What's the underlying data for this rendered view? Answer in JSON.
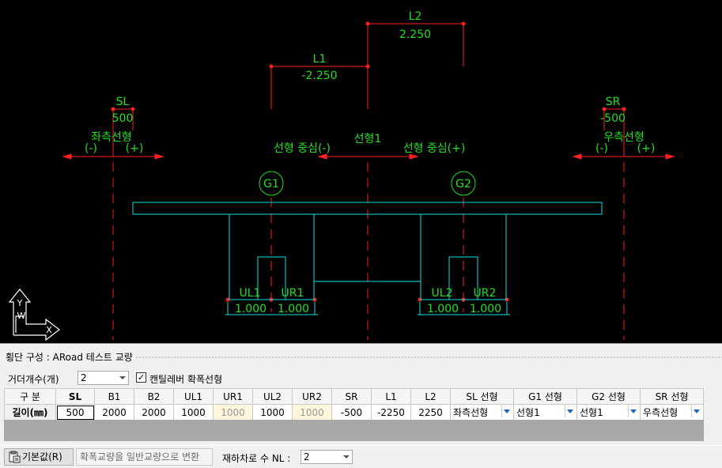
{
  "drawing": {
    "L2_label": "L2",
    "L2_value": "2.250",
    "L1_label": "L1",
    "L1_value": "-2.250",
    "SL_label": "SL",
    "SL_value": "500",
    "SR_label": "SR",
    "SR_value": "-500",
    "left_align_label": "좌측선형",
    "right_align_label": "우측선형",
    "center_align_label": "선형1",
    "center_minus_label": "선형 중심(-)",
    "center_plus_label": "선형 중심(+)",
    "minus_sign": "(-)",
    "plus_sign": "(+)",
    "G1_label": "G1",
    "G2_label": "G2",
    "UL1_label": "UL1",
    "UR1_label": "UR1",
    "UL2_label": "UL2",
    "UR2_label": "UR2",
    "UL1_value": "1.000",
    "UR1_value": "1.000",
    "UL2_value": "1.000",
    "UR2_value": "1.000",
    "axis_y": "Y",
    "axis_w": "W",
    "axis_x": "X",
    "colors": {
      "background": "#000000",
      "dimension": "#ff2020",
      "structure": "#00e0e0",
      "text": "#20e020"
    }
  },
  "panel": {
    "title": "횡단 구성 : ARoad 테스트 교량",
    "girder_count_label": "거더개수(개)",
    "girder_count_value": "2",
    "cantilever_checkbox_label": "캔틸레버 확폭선형",
    "cantilever_checked": "✓",
    "table": {
      "headers": [
        "구 분",
        "SL",
        "B1",
        "B2",
        "UL1",
        "UR1",
        "UL2",
        "UR2",
        "SR",
        "L1",
        "L2",
        "SL 선형",
        "G1 선형",
        "G2 선형",
        "SR 선형"
      ],
      "row_label": "길이(㎜)",
      "values": [
        "500",
        "2000",
        "2000",
        "1000",
        "1000",
        "1000",
        "1000",
        "-500",
        "-2250",
        "2250",
        "좌측선형",
        "선형1",
        "선형1",
        "우측선형"
      ]
    },
    "default_button": "기본값(R)",
    "convert_button": "확폭교량을 일반교량으로 변환",
    "lanes_label": "재하차로 수 NL :",
    "lanes_value": "2"
  }
}
